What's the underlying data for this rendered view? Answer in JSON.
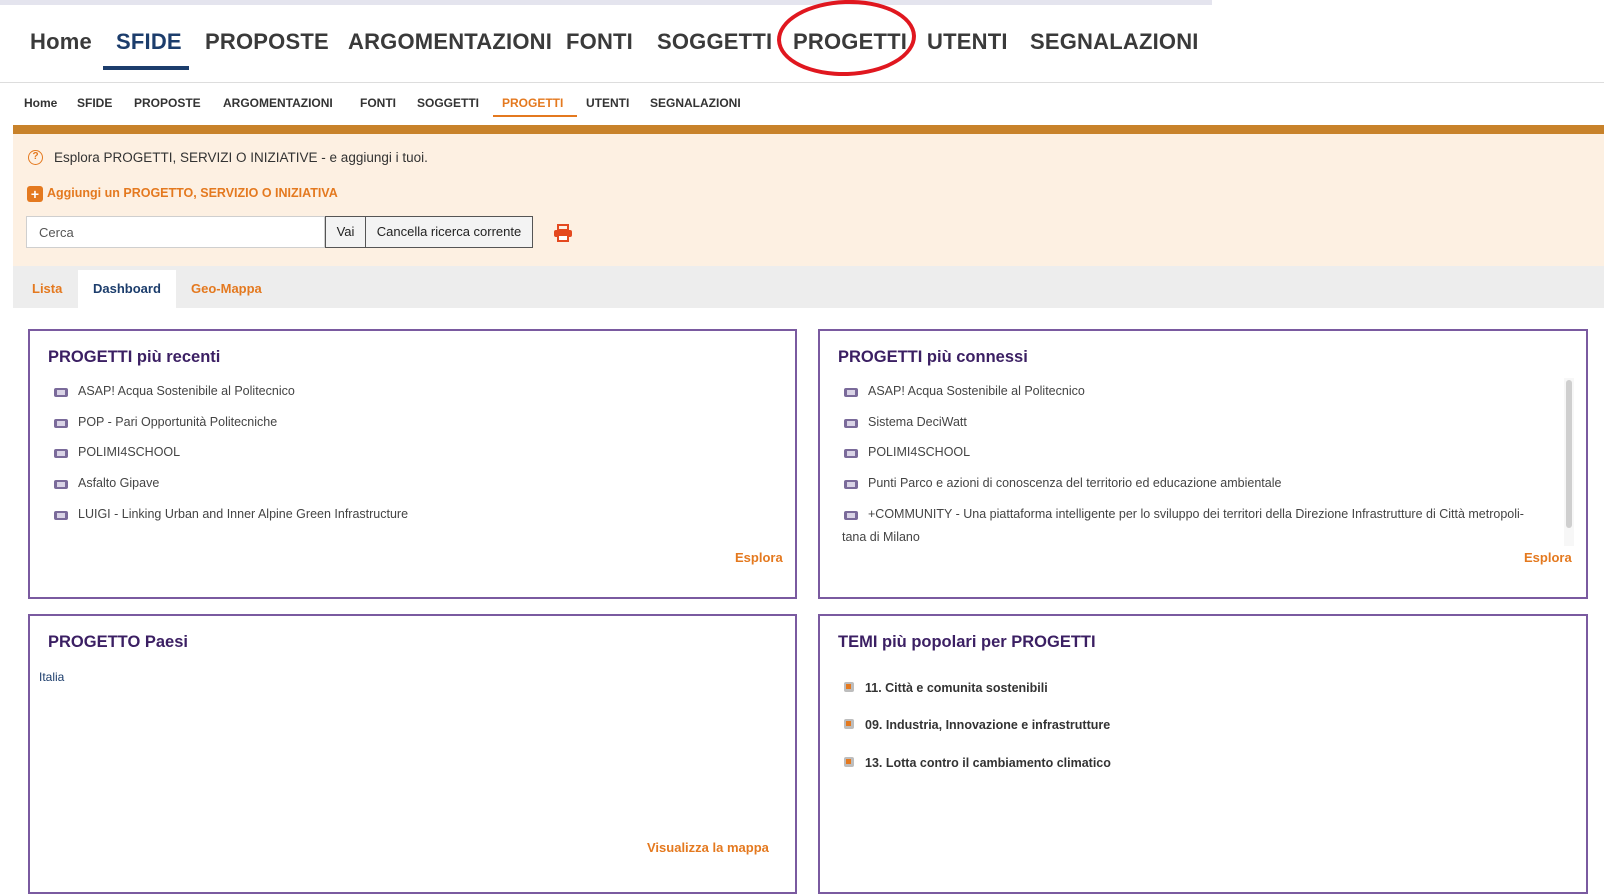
{
  "big_nav": {
    "items": [
      "Home",
      "SFIDE",
      "PROPOSTE",
      "ARGOMENTAZIONI",
      "FONTI",
      "SOGGETTI",
      "PROGETTI",
      "UTENTI",
      "SEGNALAZIONI"
    ],
    "active": "SFIDE",
    "highlighted": "PROGETTI"
  },
  "small_nav": {
    "items": [
      "Home",
      "SFIDE",
      "PROPOSTE",
      "ARGOMENTAZIONI",
      "FONTI",
      "SOGGETTI",
      "PROGETTI",
      "UTENTI",
      "SEGNALAZIONI"
    ],
    "active": "PROGETTI"
  },
  "banner": {
    "help_text": "Esplora PROGETTI, SERVIZI O INIZIATIVE - e aggiungi i tuoi.",
    "add_link": "Aggiungi un PROGETTO, SERVIZIO O INIZIATIVA"
  },
  "search": {
    "placeholder": "Cerca",
    "go_label": "Vai",
    "clear_label": "Cancella ricerca corrente"
  },
  "tabs": [
    "Lista",
    "Dashboard",
    "Geo-Mappa"
  ],
  "panels": {
    "recent": {
      "title": "PROGETTI più recenti",
      "items": [
        "ASAP! Acqua Sostenibile al Politecnico",
        "POP - Pari Opportunità Politecniche",
        "POLIMI4SCHOOL",
        "Asfalto Gipave",
        "LUIGI - Linking Urban and Inner Alpine Green Infrastructure"
      ],
      "explore": "Esplora"
    },
    "connected": {
      "title": "PROGETTI più connessi",
      "items": [
        "ASAP! Acqua Sostenibile al Politecnico",
        "Sistema DeciWatt",
        "POLIMI4SCHOOL",
        "Punti Parco e azioni di conoscenza del territorio ed educazione ambientale",
        "+COMMUNITY - Una piattaforma intelligente per lo sviluppo dei territori della Direzione Infrastrutture di Città metropoli-"
      ],
      "item_continuation": "tana di Milano",
      "explore": "Esplora"
    },
    "countries": {
      "title": "PROGETTO Paesi",
      "items": [
        "Italia"
      ],
      "map_link": "Visualizza la mappa"
    },
    "themes": {
      "title": "TEMI più popolari per PROGETTI",
      "items": [
        "11. Città e comunita sostenibili",
        "09. Industria, Innovazione e infrastrutture",
        "13. Lotta contro il cambiamento climatico"
      ]
    }
  },
  "colors": {
    "accent_orange": "#e4791f",
    "nav_blue": "#1c3d6c",
    "panel_purple": "#3b1f63",
    "highlight_red": "#e0171f"
  }
}
